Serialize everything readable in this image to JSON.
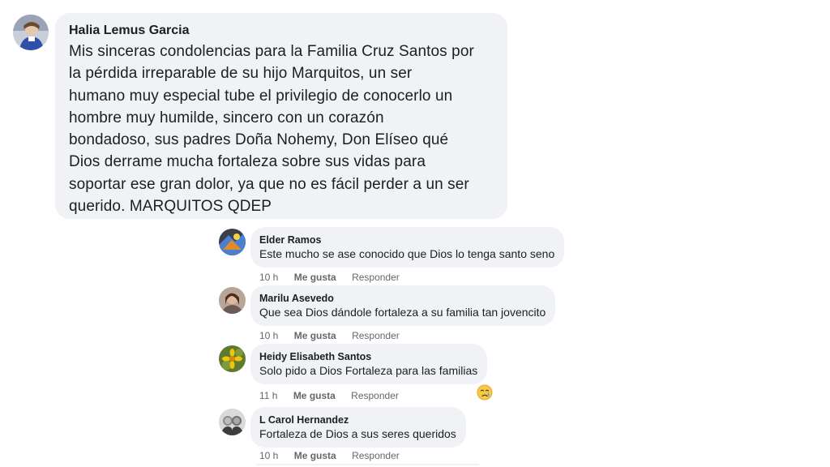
{
  "main_comment": {
    "author": "Halia Lemus Garcia",
    "text": "Mis sinceras condolencias para la Familia Cruz Santos por\nla pérdida irreparable de su hijo Marquitos, un ser\nhumano muy especial tube el privilegio de conocerlo un\nhombre muy humilde, sincero con un corazón\nbondadoso, sus padres Doña Nohemy, Don Elíseo qué\nDios derrame mucha fortaleza sobre sus vidas para\nsoportar ese gran dolor, ya que no es fácil perder a un ser\nquerido. MARQUITOS QDEP"
  },
  "replies": [
    {
      "author": "Elder Ramos",
      "text": "Este mucho se ase conocido que Dios lo tenga santo seno",
      "time": "10 h",
      "like_label": "Me gusta",
      "reply_label": "Responder"
    },
    {
      "author": "Marilu Asevedo",
      "text": "Que sea Dios dándole fortaleza a su familia tan jovencito",
      "time": "10 h",
      "like_label": "Me gusta",
      "reply_label": "Responder"
    },
    {
      "author": "Heidy Elisabeth Santos",
      "text": "Solo pido a Dios Fortaleza para las familias",
      "time": "11 h",
      "like_label": "Me gusta",
      "reply_label": "Responder",
      "reaction": "crying-face-icon"
    },
    {
      "author": "L Carol Hernandez",
      "text": "Fortaleza de Dios a sus seres queridos",
      "time": "10 h",
      "like_label": "Me gusta",
      "reply_label": "Responder"
    }
  ],
  "colors": {
    "bubble": "#f0f2f5",
    "text": "#1c1e21",
    "meta": "#65676b"
  }
}
